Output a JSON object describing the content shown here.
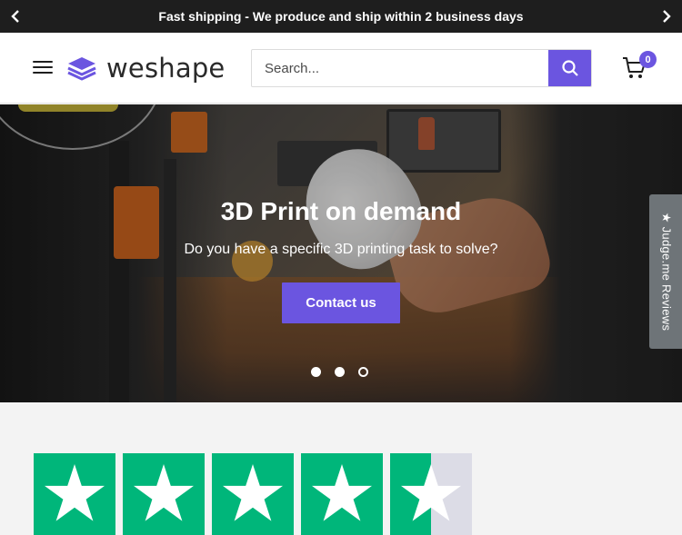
{
  "announcement": {
    "text": "Fast shipping - We produce and ship within 2 business days",
    "prev_icon": "chevron-left-icon",
    "next_icon": "chevron-right-icon"
  },
  "header": {
    "menu_icon": "hamburger-menu-icon",
    "logo_text": "weshape",
    "search": {
      "placeholder": "Search...",
      "value": ""
    },
    "cart": {
      "count": "0"
    }
  },
  "colors": {
    "brand": "#6b55e0",
    "announcement_bg": "#1e1e1e",
    "trustpilot_green": "#00b67a",
    "star_empty": "#dcdce6"
  },
  "hero": {
    "title": "3D Print on demand",
    "subtitle": "Do you have a specific 3D printing task to solve?",
    "cta_label": "Contact us",
    "slides": 3,
    "active_slide": 3
  },
  "reviews_tab": {
    "label": "★ Judge.me Reviews"
  },
  "trustpilot": {
    "rating": 4.5,
    "max": 5
  }
}
